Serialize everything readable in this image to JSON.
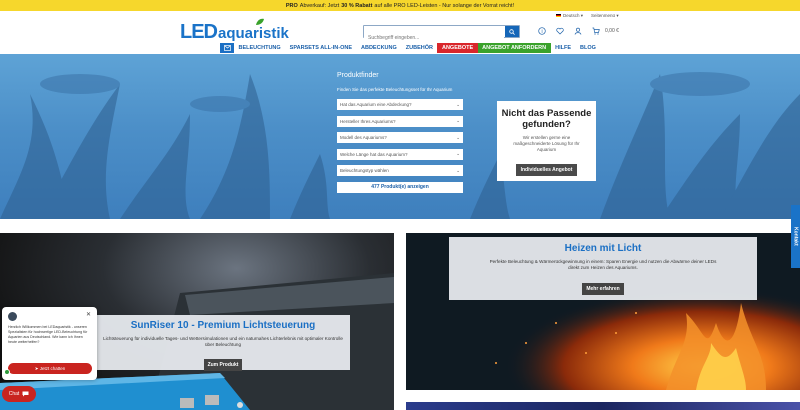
{
  "promo": {
    "p1": "PRO",
    "p2": "Abverkauf: Jetzt ",
    "p3": "30 % Rabatt",
    "p4": " auf alle PRO LED-Leisten - Nur solange der Vorrat reicht!"
  },
  "topbar": {
    "language": "Deutsch",
    "account": "Seitenmenü"
  },
  "logo": {
    "led": "LED",
    "aquaristik": "aquaristik"
  },
  "search": {
    "placeholder": "Suchbegriff eingeben..."
  },
  "cart": {
    "price": "0,00 €"
  },
  "nav": {
    "items": [
      "BELEUCHTUNG",
      "SPARSETS ALL-IN-ONE",
      "ABDECKUNG",
      "ZUBEHÖR",
      "ANGEBOTE",
      "ANGEBOT ANFORDERN",
      "HILFE",
      "BLOG"
    ]
  },
  "finder": {
    "title": "Produktfinder",
    "desc": "Finden Sie das perfekte Beleuchtungsset für Ihr Aquarium",
    "selects": [
      "Hat das Aquarium eine Abdeckung?",
      "Hersteller Ihres Aquariums?",
      "Modell des Aquariums?",
      "Welche Länge hat das Aquarium?",
      "Beleuchtungstyp wählen"
    ],
    "result": "477 Produkt(e) anzeigen"
  },
  "card": {
    "title": "Nicht das Passende gefunden?",
    "text": "Wir erstellen gerne eine maßgeschneiderte Lösung für Ihr Aquarium",
    "button": "Individuelles Angebot"
  },
  "banner1": {
    "title": "SunRiser 10 - Premium Lichtsteuerung",
    "text": "Lichtsteuerung für individuelle Tages- und Wettersimulationen und ein naturnahes Lichterlebnis mit optimaler Kontrolle über Beleuchtung",
    "button": "Zum Produkt"
  },
  "banner2": {
    "title": "Heizen mit Licht",
    "text": "Perfekte Beleuchtung & Wärmerückgewinnung in einem: Sparen Energie und nutzen die Abwärme deiner LEDs direkt zum Heizen des Aquariums.",
    "button": "Mehr erfahren"
  },
  "sidetab": "Kontakt",
  "chat": {
    "msg": "Herzlich Willkommen bei LEDaquaristik - unseren Spezialisten für hochwertige LED-Beleuchtung für Aquarien aus Deutschland. Wie kann ich Ihnen heute weiterhelfen?",
    "start": "Jetzt chatten",
    "bubble": "Chat"
  },
  "colors": {
    "brand": "#1a73c8",
    "sale": "#d9262b",
    "request": "#3aa22b",
    "promo": "#f6d72c"
  }
}
